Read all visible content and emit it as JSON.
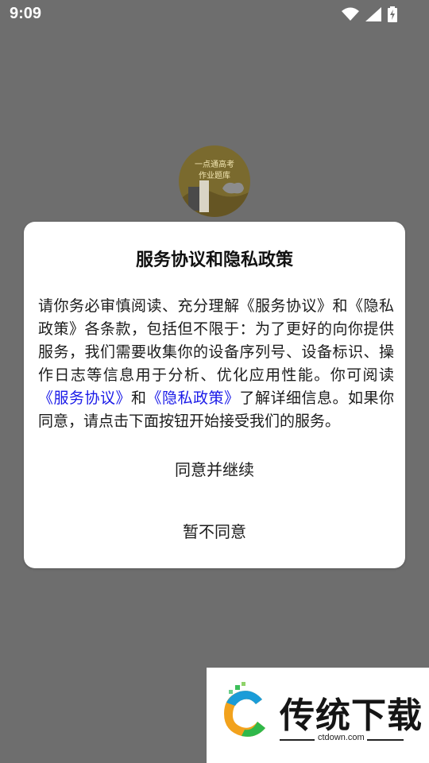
{
  "status_bar": {
    "time": "9:09",
    "icons": [
      "wifi-icon",
      "signal-icon",
      "battery-charging-icon"
    ]
  },
  "app_logo": {
    "line1": "一点通高考",
    "line2": "作业题库"
  },
  "dialog": {
    "title": "服务协议和隐私政策",
    "body_part1": "请你务必审慎阅读、充分理解《服务协议》和《隐私政策》各条款，包括但不限于：为了更好的向你提供服务，我们需要收集你的设备序列号、设备标识、操作日志等信息用于分析、优化应用性能。你可阅读",
    "link_service": "《服务协议》",
    "connector": "和",
    "link_privacy": "《隐私政策》",
    "body_part2": "了解详细信息。如果你同意，请点击下面按钮开始接受我们的服务。",
    "agree_button": "同意并继续",
    "decline_button": "暂不同意"
  },
  "watermark": {
    "title": "传统下载",
    "url": "ctdown.com"
  },
  "colors": {
    "overlay": "#6e6e6e",
    "link": "#1a1ae8"
  }
}
